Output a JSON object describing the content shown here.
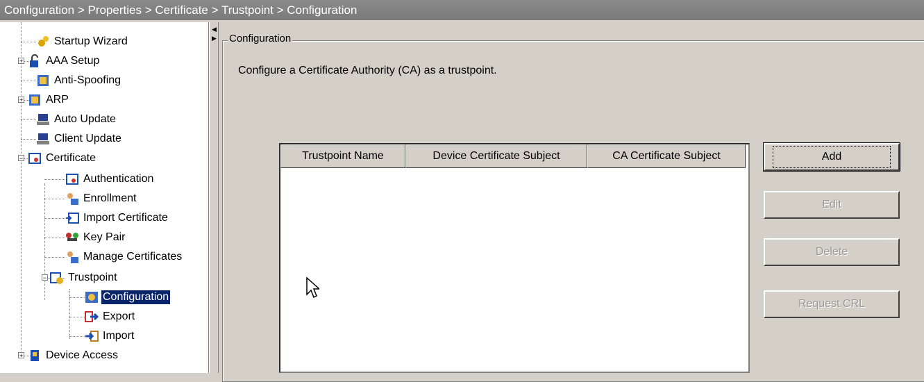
{
  "breadcrumb": "Configuration > Properties > Certificate > Trustpoint > Configuration",
  "tree": {
    "items": [
      {
        "label": "Startup Wizard",
        "icon": "wizard-icon"
      },
      {
        "label": "AAA Setup",
        "icon": "lock-icon"
      },
      {
        "label": "Anti-Spoofing",
        "icon": "shield-icon"
      },
      {
        "label": "ARP",
        "icon": "network-icon"
      },
      {
        "label": "Auto Update",
        "icon": "computer-icon"
      },
      {
        "label": "Client Update",
        "icon": "computer-icon"
      },
      {
        "label": "Certificate",
        "icon": "certificate-icon"
      },
      {
        "label": "Authentication",
        "icon": "certificate-icon"
      },
      {
        "label": "Enrollment",
        "icon": "users-icon"
      },
      {
        "label": "Import Certificate",
        "icon": "import-certificate-icon"
      },
      {
        "label": "Key Pair",
        "icon": "key-icon"
      },
      {
        "label": "Manage Certificates",
        "icon": "users-icon"
      },
      {
        "label": "Trustpoint",
        "icon": "trustpoint-icon"
      },
      {
        "label": "Configuration",
        "icon": "configuration-icon"
      },
      {
        "label": "Export",
        "icon": "export-icon"
      },
      {
        "label": "Import",
        "icon": "import-icon"
      },
      {
        "label": "Device Access",
        "icon": "device-access-icon"
      }
    ]
  },
  "main": {
    "group_title": "Configuration",
    "description": "Configure a Certificate Authority (CA) as a trustpoint.",
    "table": {
      "columns": [
        "Trustpoint Name",
        "Device Certificate Subject",
        "CA Certificate Subject"
      ],
      "rows": []
    },
    "buttons": {
      "add": "Add",
      "edit": "Edit",
      "delete": "Delete",
      "request_crl": "Request CRL"
    }
  },
  "colors": {
    "selection": "#0a246a",
    "panel": "#d4d0c8",
    "titlebar": "#808080"
  }
}
